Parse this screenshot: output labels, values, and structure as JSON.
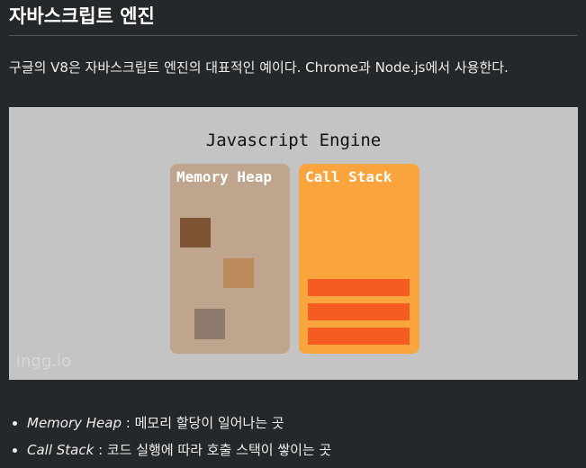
{
  "title": "자바스크립트 엔진",
  "intro": "구글의 V8은 자바스크립트 엔진의 대표적인 예이다. Chrome과 Node.js에서 사용한다.",
  "figure": {
    "title": "Javascript Engine",
    "heap_label": "Memory Heap",
    "stack_label": "Call Stack",
    "watermark": "ingg.io",
    "colors": {
      "heap": "#bfa58d",
      "stack": "#f9a43d",
      "frame": "#f45c22"
    }
  },
  "bullets": [
    {
      "term": "Memory Heap",
      "desc": " : 메모리 할당이 일어나는 곳"
    },
    {
      "term": "Call Stack",
      "desc": " : 코드 실행에 따라 호출 스택이 쌓이는 곳"
    }
  ]
}
